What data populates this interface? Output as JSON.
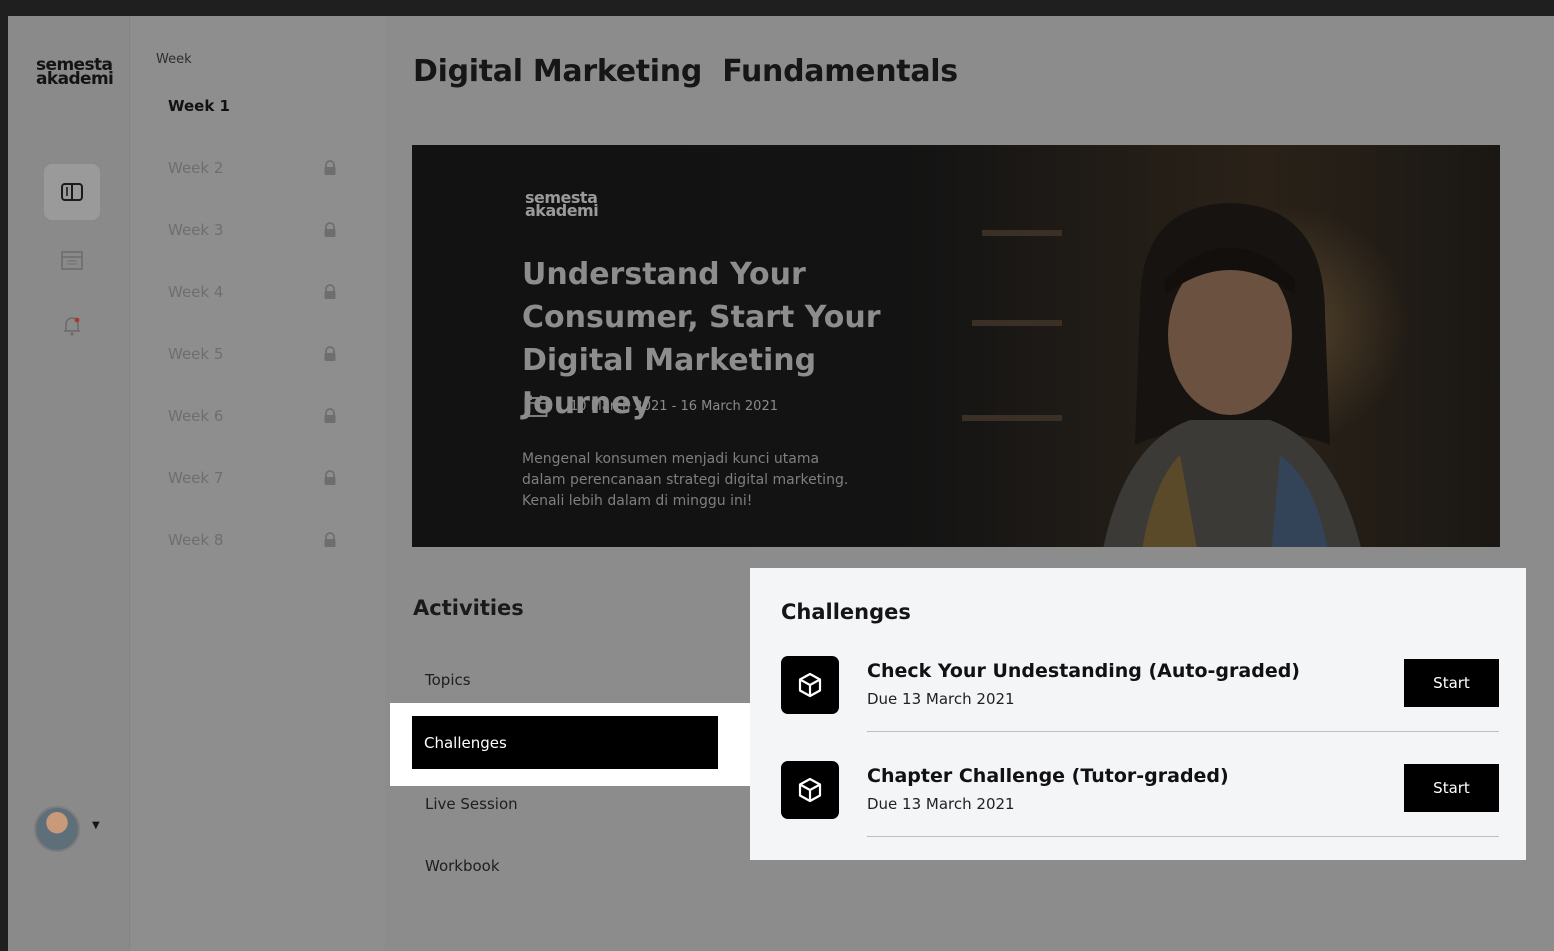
{
  "brand": {
    "line1": "semesta",
    "line2": "akademi"
  },
  "rail": {
    "items": [
      "book-icon",
      "calendar-icon",
      "bell-icon"
    ]
  },
  "weeks": {
    "heading": "Week",
    "items": [
      {
        "label": "Week 1",
        "locked": false
      },
      {
        "label": "Week 2",
        "locked": true
      },
      {
        "label": "Week 3",
        "locked": true
      },
      {
        "label": "Week 4",
        "locked": true
      },
      {
        "label": "Week 5",
        "locked": true
      },
      {
        "label": "Week 6",
        "locked": true
      },
      {
        "label": "Week 7",
        "locked": true
      },
      {
        "label": "Week 8",
        "locked": true
      }
    ]
  },
  "page": {
    "title": "Digital Marketing  Fundamentals"
  },
  "banner": {
    "logo1": "semesta",
    "logo2": "akademi",
    "title": "Understand Your Consumer, Start Your Digital Marketing Journey",
    "date": "10 March 2021 - 16 March 2021",
    "description": "Mengenal konsumen menjadi kunci utama dalam perencanaan strategi digital marketing. Kenali lebih dalam di minggu ini!"
  },
  "activities": {
    "heading": "Activities",
    "items": [
      "Topics",
      "Challenges",
      "Live Session",
      "Workbook"
    ],
    "active": "Challenges"
  },
  "challenges": {
    "heading": "Challenges",
    "items": [
      {
        "title": "Check Your Undestanding (Auto-graded)",
        "due": "Due 13 March 2021",
        "button": "Start"
      },
      {
        "title": "Chapter Challenge (Tutor-graded)",
        "due": "Due 13 March 2021",
        "button": "Start"
      }
    ]
  },
  "colors": {
    "accent": "#000000",
    "panel": "#f4f5f7",
    "overlay": "#8c8c8c"
  }
}
